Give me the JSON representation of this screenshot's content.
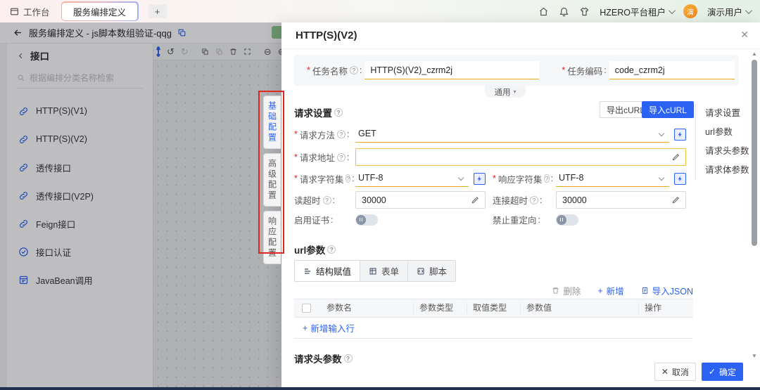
{
  "topbar": {
    "tab_workbench": "工作台",
    "tab_active": "服务编排定义",
    "tenant": "HZERO平台租户",
    "user": "演示用户",
    "avatar_char": "演"
  },
  "breadcrumb": {
    "title": "服务编排定义 - js脚本数组验证-qqg"
  },
  "sidebar": {
    "header": "接口",
    "search_placeholder": "根据编排分类名称检索",
    "items": [
      {
        "label": "HTTP(S)(V1)"
      },
      {
        "label": "HTTP(S)(V2)"
      },
      {
        "label": "透传接口"
      },
      {
        "label": "透传接口(V2P)"
      },
      {
        "label": "Feign接口"
      },
      {
        "label": "接口认证"
      },
      {
        "label": "JavaBean调用"
      }
    ]
  },
  "vertical_tabs": [
    {
      "label": "基础配置"
    },
    {
      "label": "高级配置"
    },
    {
      "label": "响应配置"
    }
  ],
  "drawer": {
    "title": "HTTP(S)(V2)",
    "basic": {
      "task_name_label": "任务名称",
      "task_name_value": "HTTP(S)(V2)_czrm2j",
      "task_code_label": "任务编码",
      "task_code_value": "code_czrm2j",
      "collapse_label": "通用"
    },
    "request": {
      "section_title": "请求设置",
      "export_curl": "导出cURL",
      "import_curl": "导入cURL",
      "method_label": "请求方法",
      "method_value": "GET",
      "address_label": "请求地址",
      "req_charset_label": "请求字符集",
      "req_charset_value": "UTF-8",
      "resp_charset_label": "响应字符集",
      "resp_charset_value": "UTF-8",
      "read_timeout_label": "读超时",
      "read_timeout_value": "30000",
      "conn_timeout_label": "连接超时",
      "conn_timeout_value": "30000",
      "cert_label": "启用证书",
      "redirect_label": "禁止重定向"
    },
    "anchors": [
      {
        "label": "请求设置"
      },
      {
        "label": "url参数"
      },
      {
        "label": "请求头参数"
      },
      {
        "label": "请求体参数"
      }
    ],
    "url_params": {
      "section_title": "url参数",
      "tabs": [
        {
          "label": "结构赋值"
        },
        {
          "label": "表单"
        },
        {
          "label": "脚本"
        }
      ],
      "delete_label": "删除",
      "add_label": "新增",
      "import_json_label": "导入JSON",
      "columns": [
        {
          "label": "参数名"
        },
        {
          "label": "参数类型"
        },
        {
          "label": "取值类型"
        },
        {
          "label": "参数值"
        },
        {
          "label": "操作"
        }
      ],
      "add_row_label": "新增输入行"
    },
    "header_params_title": "请求头参数",
    "footer": {
      "cancel": "取消",
      "ok": "确定"
    }
  }
}
